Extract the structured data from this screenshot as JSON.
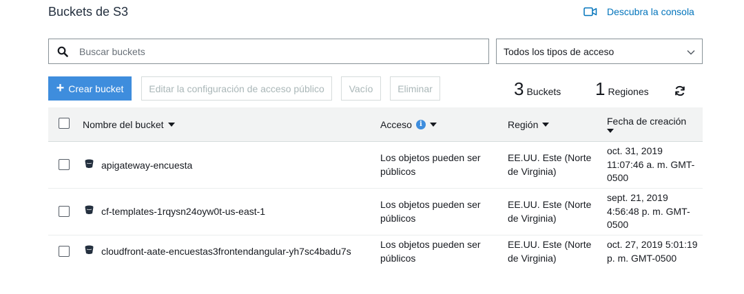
{
  "header": {
    "title": "Buckets de S3",
    "console_link": "Descubra la consola"
  },
  "search": {
    "placeholder": "Buscar buckets",
    "value": ""
  },
  "access_filter": {
    "selected": "Todos los tipos de acceso"
  },
  "toolbar": {
    "create_label": "Crear bucket",
    "edit_public_access_label": "Editar la configuración de acceso público",
    "empty_label": "Vacío",
    "delete_label": "Eliminar"
  },
  "summary": {
    "buckets_count": "3",
    "buckets_label": "Buckets",
    "regions_count": "1",
    "regions_label": "Regiones"
  },
  "table": {
    "columns": {
      "name": "Nombre del bucket",
      "access": "Acceso",
      "region": "Región",
      "created": "Fecha de creación"
    },
    "rows": [
      {
        "name": "apigateway-encuesta",
        "access_line1": "Los objetos pueden ser",
        "access_line2": "públicos",
        "region_line1": "EE.UU. Este (Norte",
        "region_line2": "de Virginia)",
        "created_line1": "oct. 31, 2019",
        "created_line2": "11:07:46 a. m. GMT-",
        "created_line3": "0500"
      },
      {
        "name": "cf-templates-1rqysn24oyw0t-us-east-1",
        "access_line1": "Los objetos pueden ser",
        "access_line2": "públicos",
        "region_line1": "EE.UU. Este (Norte",
        "region_line2": "de Virginia)",
        "created_line1": "sept. 21, 2019",
        "created_line2": "4:56:48 p. m. GMT-",
        "created_line3": "0500"
      },
      {
        "name": "cloudfront-aate-encuestas3frontendangular-yh7sc4badu7s",
        "access_line1": "Los objetos pueden ser",
        "access_line2": "públicos",
        "region_line1": "EE.UU. Este (Norte",
        "region_line2": "de Virginia)",
        "created_line1": "oct. 27, 2019 5:01:19",
        "created_line2": "p. m. GMT-0500",
        "created_line3": ""
      }
    ]
  },
  "colors": {
    "primary": "#3e8ddd",
    "link": "#0073bb",
    "header_bg": "#f2f3f3"
  },
  "icons": [
    "video-camera-icon",
    "search-icon",
    "chevron-down-icon",
    "plus-icon",
    "refresh-icon",
    "info-icon",
    "sort-caret-icon",
    "bucket-icon"
  ]
}
